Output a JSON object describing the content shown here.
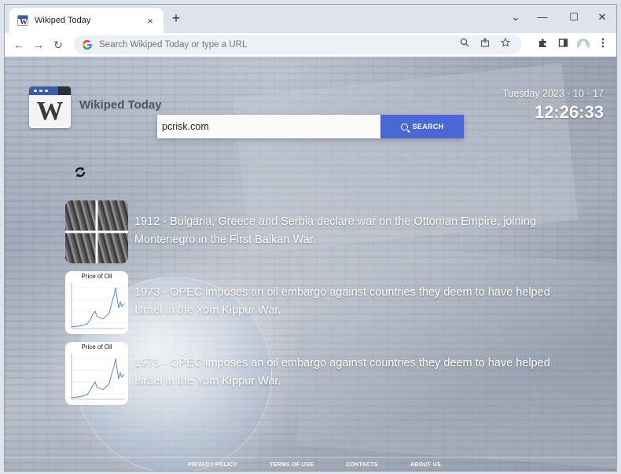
{
  "browser": {
    "tab_title": "Wikiped Today",
    "tab_close": "×",
    "new_tab": "+",
    "window_controls": {
      "dropdown": "⌄",
      "minimize": "—",
      "maximize": "☐",
      "close": "✕"
    },
    "nav": {
      "back": "←",
      "forward": "→",
      "reload": "↻"
    },
    "omnibox_placeholder": "Search Wikiped Today or type a URL",
    "icons": [
      "google-icon",
      "zoom-icon",
      "share-icon",
      "bookmark-star-icon",
      "extensions-icon",
      "side-panel-icon",
      "profile-icon",
      "menu-icon"
    ]
  },
  "page": {
    "brand": "Wikiped Today",
    "logo_letter": "W",
    "date": "Tuesday 2023 - 10 - 17",
    "time": "12:26:33",
    "search_value": "pcrisk.com",
    "search_button": "SEARCH",
    "events": [
      {
        "text": "1912 - Bulgaria, Greece and Serbia declare war on the Ottoman Empire, joining Montenegro in the First Balkan War.",
        "thumb": "photo"
      },
      {
        "text": "1973 - OPEC imposes an oil embargo against countries they deem to have helped Israel in the Yom Kippur War.",
        "thumb": "chart",
        "thumb_title": "Price of Oil"
      },
      {
        "text": "1973 - OPEC imposes an oil embargo against countries they deem to have helped Israel in the Yom Kippur War.",
        "thumb": "chart",
        "thumb_title": "Price of Oil"
      }
    ],
    "footer": {
      "privacy": "PRIVACY POLICY",
      "terms": "TERMS OF USE",
      "contacts": "CONTACTS",
      "about": "ABOUT US"
    }
  },
  "colors": {
    "accent": "#4a67d6",
    "brand_blue": "#3a5da8"
  }
}
